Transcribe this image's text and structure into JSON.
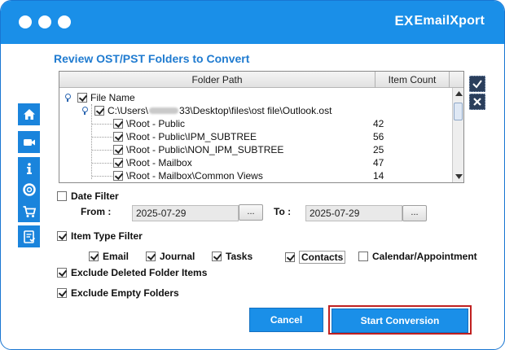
{
  "app": {
    "logo_mark": "EX",
    "logo_text": "EmailXport"
  },
  "heading": "Review OST/PST Folders to Convert",
  "sidebar": {
    "items": [
      {
        "icon": "home-icon"
      },
      {
        "icon": "video-icon"
      },
      {
        "icon": "info-icon"
      },
      {
        "icon": "support-icon"
      },
      {
        "icon": "cart-icon"
      },
      {
        "icon": "license-icon"
      }
    ]
  },
  "tree": {
    "col_folder_path": "Folder Path",
    "col_item_count": "Item Count",
    "root_label": "File Name",
    "file_path_prefix": "C:\\Users\\",
    "file_path_suffix": "33\\Desktop\\files\\ost file\\Outlook.ost",
    "folders": [
      {
        "name": "\\Root - Public",
        "count": "42"
      },
      {
        "name": "\\Root - Public\\IPM_SUBTREE",
        "count": "56"
      },
      {
        "name": "\\Root - Public\\NON_IPM_SUBTREE",
        "count": "25"
      },
      {
        "name": "\\Root - Mailbox",
        "count": "47"
      },
      {
        "name": "\\Root - Mailbox\\Common Views",
        "count": "14"
      }
    ]
  },
  "date_filter": {
    "label": "Date Filter",
    "checked": false,
    "from_label": "From :",
    "from_value": "2025-07-29",
    "to_label": "To :",
    "to_value": "2025-07-29",
    "picker_label": "..."
  },
  "item_type_filter": {
    "label": "Item Type Filter",
    "checked": true,
    "types": [
      {
        "label": "Email",
        "checked": true
      },
      {
        "label": "Journal",
        "checked": true
      },
      {
        "label": "Tasks",
        "checked": true
      },
      {
        "label": "Contacts",
        "checked": true
      },
      {
        "label": "Calendar/Appointment",
        "checked": false
      }
    ]
  },
  "exclude_deleted": {
    "label": "Exclude Deleted Folder Items",
    "checked": true
  },
  "exclude_empty": {
    "label": "Exclude Empty Folders",
    "checked": true
  },
  "buttons": {
    "cancel": "Cancel",
    "start": "Start Conversion"
  },
  "colors": {
    "accent": "#1a8fe8",
    "heading": "#1f7bd0",
    "highlight": "#c02020"
  }
}
